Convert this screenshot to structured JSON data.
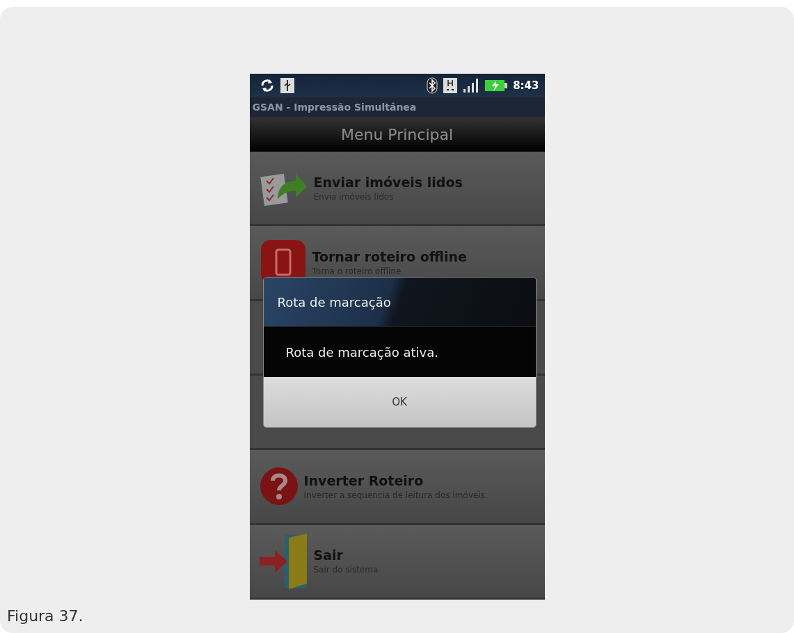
{
  "phone": {
    "status_bar": {
      "time": "8:43"
    },
    "app_title": "GSAN - Impressão Simultânea",
    "header": "Menu Principal",
    "menu_items": [
      {
        "kind": "send",
        "title": "Enviar imóveis lidos",
        "subtitle": "Envia imóveis lidos"
      },
      {
        "kind": "offline",
        "title": "Tornar roteiro offline",
        "subtitle": "Torna o roteiro offline"
      },
      {
        "kind": "covered"
      },
      {
        "kind": "covered"
      },
      {
        "kind": "help",
        "title": "Inverter Roteiro",
        "subtitle": "Inverter a sequencia de leitura dos imóveis."
      },
      {
        "kind": "exit",
        "title": "Sair",
        "subtitle": "Sair do sistema"
      }
    ],
    "dialog": {
      "title": "Rota de marcação",
      "message": "Rota de marcação ativa.",
      "button": "OK"
    }
  },
  "caption": "Figura 37."
}
